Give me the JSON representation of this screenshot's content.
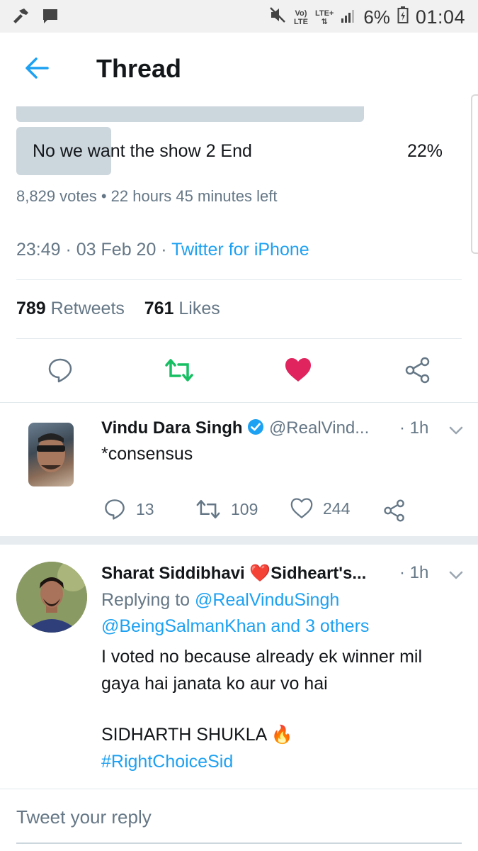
{
  "status_bar": {
    "network_top": "Vo)",
    "network_bottom": "LTE",
    "lte_label": "LTE+",
    "battery": "6%",
    "time": "01:04"
  },
  "header": {
    "title": "Thread"
  },
  "poll": {
    "option_label": "No we want the show 2 End",
    "option_percent": "22%",
    "option_fill": 0.22,
    "meta": "8,829 votes • 22 hours 45 minutes left"
  },
  "tweet": {
    "timestamp": "23:49 · 03 Feb 20 · ",
    "source": "Twitter for iPhone",
    "retweets_count": "789",
    "retweets_label": "Retweets",
    "likes_count": "761",
    "likes_label": "Likes"
  },
  "replies": [
    {
      "name": "Vindu Dara Singh",
      "handle": "@RealVind...",
      "time": "· 1h",
      "text": "*consensus",
      "reply_count": "13",
      "retweet_count": "109",
      "like_count": "244"
    },
    {
      "name": "Sharat Siddibhavi ❤️Sidheart's...",
      "time": "· 1h",
      "replying_prefix": "Replying to ",
      "replying_to_1": "@RealVinduSingh",
      "replying_to_2": "@BeingSalmanKhan and 3 others",
      "text_line1": "I voted no because already ek winner mil",
      "text_line2": "gaya hai janata ko aur vo hai",
      "text_line3": "SIDHARTH SHUKLA 🔥",
      "hashtag": "#RightChoiceSid"
    }
  ],
  "compose": {
    "placeholder": "Tweet your reply"
  },
  "colors": {
    "accent": "#1da1f2",
    "retweet_green": "#17bf63",
    "like_red": "#e0245e",
    "poll_fill": "#ccd6dd",
    "muted": "#657786"
  }
}
